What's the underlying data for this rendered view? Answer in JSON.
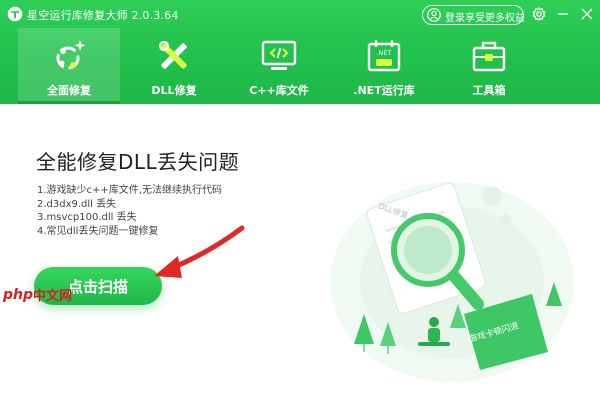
{
  "app": {
    "title": "星空运行库修复大师 2.0.3.64",
    "login_label": "登录享受更多权益",
    "colors": {
      "brand": "#22c04c",
      "brand_dark": "#1a9e3d",
      "watermark": "#d42020"
    }
  },
  "window_controls": {
    "settings_icon": "gear-icon",
    "minimize_icon": "minimize-icon",
    "close_icon": "close-icon"
  },
  "nav": {
    "tabs": [
      {
        "label": "全面修复",
        "icon": "repair-sparkle-icon",
        "active": true
      },
      {
        "label": "DLL修复",
        "icon": "tools-cross-icon",
        "active": false
      },
      {
        "label": "C++库文件",
        "icon": "code-monitor-icon",
        "active": false
      },
      {
        "label": ".NET运行库",
        "icon": "net-calendar-icon",
        "active": false
      },
      {
        "label": "工具箱",
        "icon": "toolbox-icon",
        "active": false
      }
    ]
  },
  "main": {
    "title": "全能修复DLL丢失问题",
    "issues": [
      "1.游戏缺少c++库文件,无法继续执行代码",
      "2.d3dx9.dll 丢失",
      "3.msvcp100.dll 丢失",
      "4.常见dll丢失问题一键修复"
    ],
    "scan_button": "点击扫描"
  },
  "illustration": {
    "card_label": "DLL修复",
    "banner_label": "游戏卡顿闪退"
  },
  "watermark": {
    "text": "中文网",
    "logo": "php"
  }
}
